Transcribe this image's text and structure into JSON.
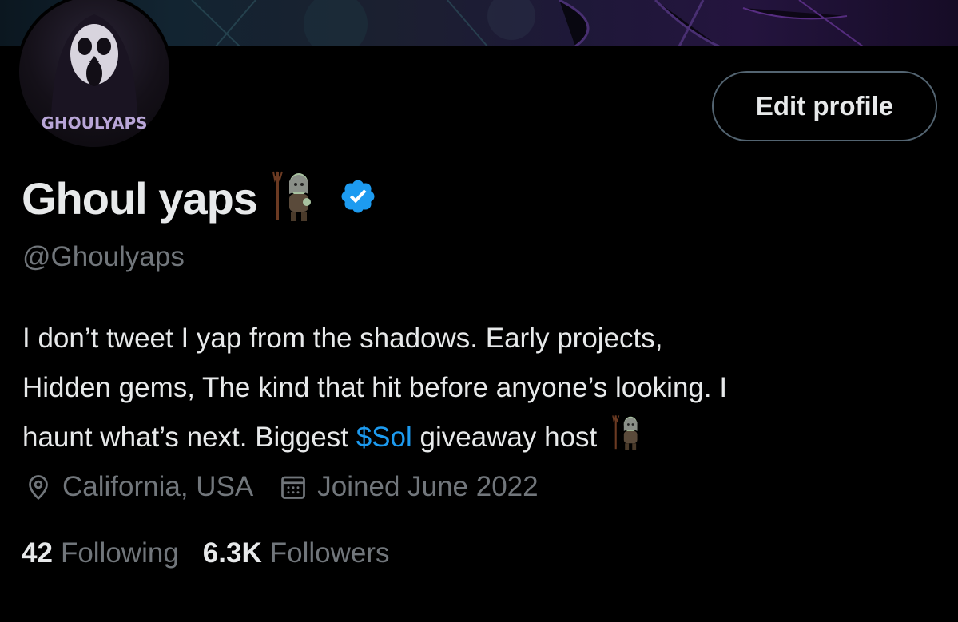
{
  "profile": {
    "avatar_text": "GHOULYAPS",
    "display_name": "Ghoul yaps",
    "handle": "@Ghoulyaps",
    "edit_profile_label": "Edit profile",
    "bio": {
      "line1": "I don’t tweet I yap from the shadows. Early projects,",
      "line2": "Hidden gems, The kind that hit before anyone’s looking. I",
      "line3_before": "haunt what’s next. Biggest ",
      "cashtag": "$Sol",
      "line3_after": " giveaway host"
    },
    "location": "California, USA",
    "joined": "Joined June 2022",
    "following_count": "42",
    "following_label": "Following",
    "followers_count": "6.3K",
    "followers_label": "Followers"
  },
  "icons": {
    "verified": "verified-badge-icon",
    "location": "location-pin-icon",
    "calendar": "calendar-icon",
    "emoji": "ghoul-emoji-icon"
  },
  "colors": {
    "background": "#000000",
    "text_primary": "#e7e9ea",
    "text_secondary": "#71767b",
    "accent": "#1d9bf0",
    "border": "#536471",
    "avatar_text": "#b9a6d8"
  }
}
